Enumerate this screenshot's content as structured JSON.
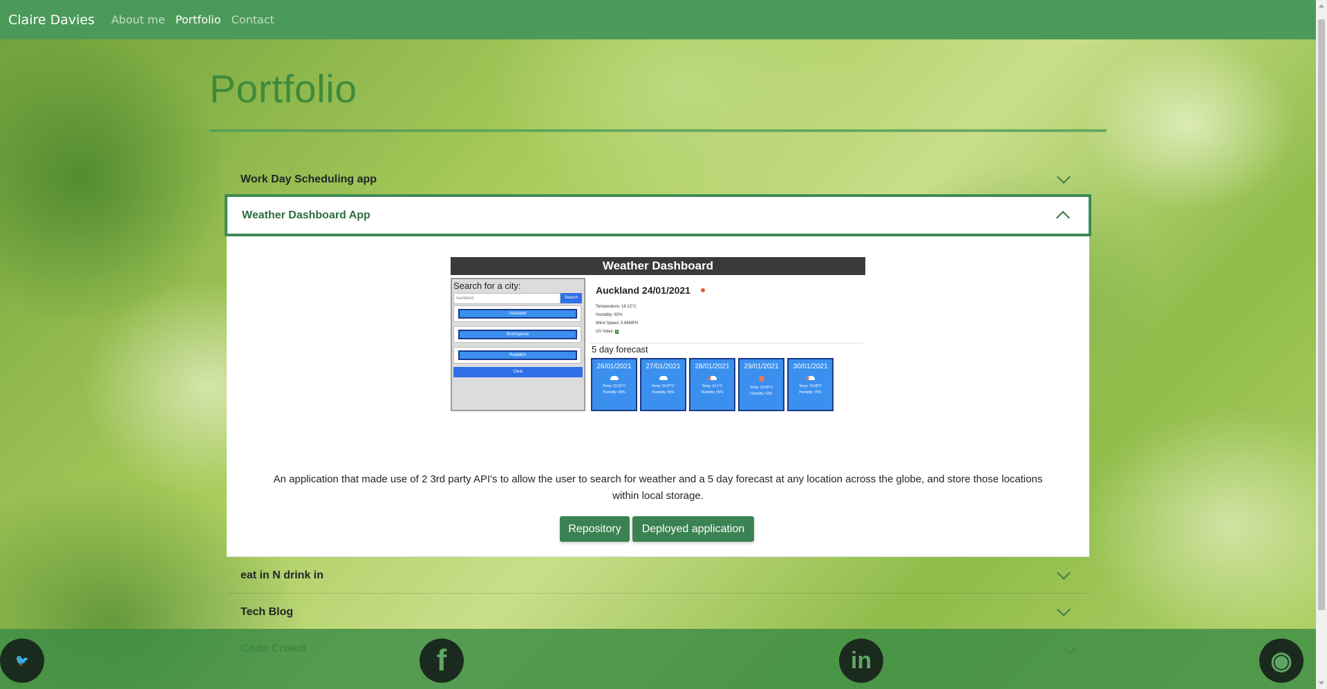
{
  "navbar": {
    "brand": "Claire Davies",
    "links": [
      {
        "label": "About me",
        "active": false
      },
      {
        "label": "Portfolio",
        "active": true
      },
      {
        "label": "Contact",
        "active": false
      }
    ]
  },
  "page": {
    "title": "Portfolio"
  },
  "accordion": {
    "items": [
      {
        "title": "Work Day Scheduling app",
        "expanded": false
      },
      {
        "title": "Weather Dashboard App",
        "expanded": true
      },
      {
        "title": "eat in N drink in",
        "expanded": false
      },
      {
        "title": "Tech Blog",
        "expanded": false
      },
      {
        "title": "Code Crowd",
        "expanded": false
      }
    ],
    "open": {
      "screenshot": {
        "header": "Weather Dashboard",
        "search_label": "Search for a city:",
        "search_value": "Auckland",
        "search_button": "Search",
        "cities": [
          "Auckland",
          "Bromsgrove",
          "Redditch"
        ],
        "clear_button": "Clear",
        "current_title": "Auckland 24/01/2021",
        "details": [
          "Temperature: 18.12°C",
          "Humidity: 82%",
          "Wind Speed: 5.66MPH"
        ],
        "uv_label": "UV Index:",
        "uv_value": "1",
        "forecast_title": "5 day forecast",
        "forecast": [
          {
            "date": "26/01/2021",
            "temp": "Temp: 23.52°C",
            "humidity": "Humidity: 60%",
            "icon": "cloud-icon"
          },
          {
            "date": "27/01/2021",
            "temp": "Temp: 24.87°C",
            "humidity": "Humidity: 56%",
            "icon": "cloud-icon"
          },
          {
            "date": "28/01/2021",
            "temp": "Temp: 24.1°C",
            "humidity": "Humidity: 55%",
            "icon": "partly-cloudy-icon"
          },
          {
            "date": "29/01/2021",
            "temp": "Temp: 20.69°C",
            "humidity": "Humidity: 52%",
            "icon": "sun-icon"
          },
          {
            "date": "30/01/2021",
            "temp": "Temp: 19.98°C",
            "humidity": "Humidity: 70%",
            "icon": "partly-cloudy-icon"
          }
        ]
      },
      "description": "An application that made use of 2 3rd party API's to allow the user to search for weather and a 5 day forecast at any location across the globe, and store those locations within local storage.",
      "buttons": {
        "repository": "Repository",
        "deployed": "Deployed application"
      }
    }
  },
  "footer": {
    "icons": [
      "twitter-icon",
      "facebook-icon",
      "linkedin-icon",
      "github-icon"
    ],
    "icon_glyphs": [
      "🐦",
      "f",
      "in",
      "◉"
    ]
  },
  "colors": {
    "navbar": "#4c9a59",
    "accent": "#3e8a55",
    "button": "#3b8252",
    "title": "#3f8a3a"
  }
}
